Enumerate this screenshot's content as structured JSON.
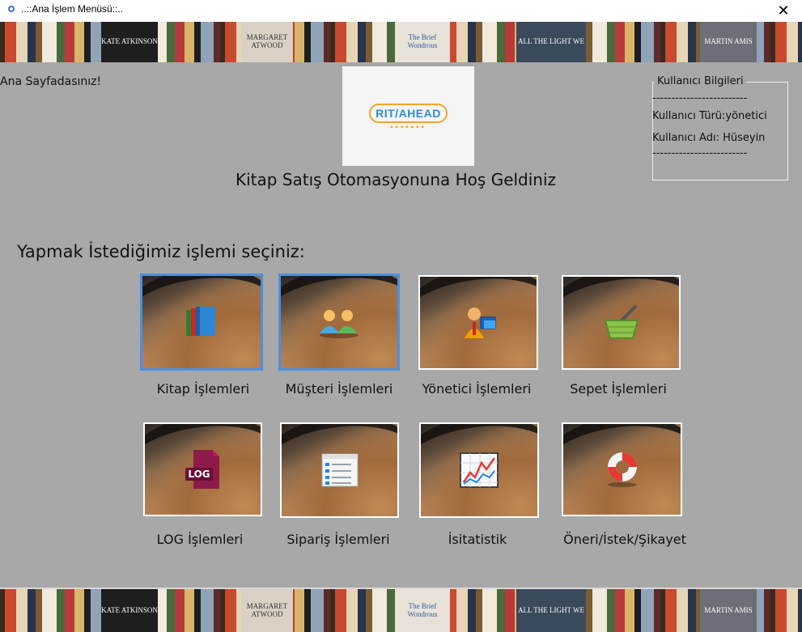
{
  "window": {
    "title": "..::Ana İşlem Menüsü::..",
    "close_glyph": "✕"
  },
  "banner": {
    "covers": [
      "KATE ATKINSON",
      "MARGARET ATWOOD",
      "The Brief Wondrous",
      "ALL THE LIGHT WE",
      "MARTIN AMIS"
    ]
  },
  "header": {
    "greeting": "Ana Sayfadasınız!",
    "logo_text": "RIT/AHEAD",
    "welcome": "Kitap Satış Otomasyonuna Hoş Geldiniz"
  },
  "user_info": {
    "legend": "Kullanıcı Bilgileri",
    "separator": "-------------------------",
    "type_line": "Kullanıcı Türü:yönetici",
    "name_line": "Kullanıcı Adı: Hüseyin"
  },
  "menu": {
    "prompt": "Yapmak İstediğimiz işlemi seçiniz:",
    "items": [
      {
        "label": "Kitap İşlemleri",
        "icon": "books-icon"
      },
      {
        "label": "Müşteri İşlemleri",
        "icon": "customers-icon"
      },
      {
        "label": "Yönetici İşlemleri",
        "icon": "admin-icon"
      },
      {
        "label": "Sepet İşlemleri",
        "icon": "basket-icon"
      },
      {
        "label": "LOG İşlemleri",
        "icon": "log-file-icon",
        "icon_text": "LOG"
      },
      {
        "label": "Sipariş İşlemleri",
        "icon": "order-list-icon"
      },
      {
        "label": "İsitatistik",
        "icon": "statistics-chart-icon"
      },
      {
        "label": "Öneri/İstek/Şikayet",
        "icon": "lifebuoy-icon"
      }
    ]
  },
  "colors": {
    "background": "#a8a8a8",
    "selected_border": "#4a90e2",
    "tile_border": "#ffffff"
  }
}
